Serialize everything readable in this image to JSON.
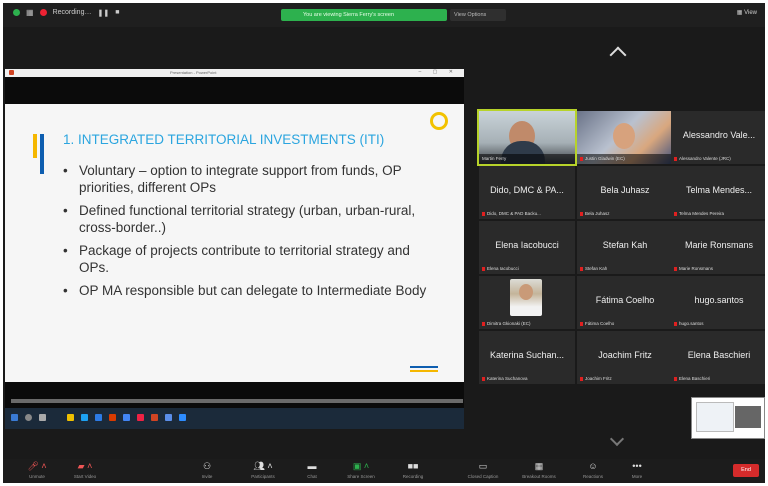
{
  "topbar": {
    "meeting_title": "Recording…",
    "share_banner": "You are viewing Sierra Ferry's screen",
    "view_options": "View Options",
    "view_button": "View"
  },
  "shared_screen": {
    "window_title": "Presentation - PowerPoint"
  },
  "slide": {
    "title": "1. INTEGRATED TERRITORIAL INVESTMENTS (ITI)",
    "bullets": [
      "Voluntary – option to integrate support from funds, OP priorities, different OPs",
      "Defined functional territorial strategy (urban, urban-rural, cross-border..)",
      "Package of projects contribute to territorial strategy and OPs.",
      "OP MA responsible but can delegate to Intermediate Body"
    ],
    "accent_blue": "#2ba5df",
    "accent_yellow": "#f5b700"
  },
  "gallery": {
    "tiles": [
      {
        "name": "",
        "tag": "Martin Ferry",
        "video": true
      },
      {
        "name": "",
        "tag": "Justin Gladwin (EC)",
        "video": true
      },
      {
        "name": "Alessandro Vale...",
        "tag": "Alessandro Valente (JRC)",
        "video": false
      },
      {
        "name": "Dido, DMC & PA...",
        "tag": "Dido, DMC & PAD Backu...",
        "video": false
      },
      {
        "name": "Bela Juhasz",
        "tag": "Bela Juhasz",
        "video": false
      },
      {
        "name": "Telma Mendes...",
        "tag": "Telma Mendes Pereira",
        "video": false
      },
      {
        "name": "Elena Iacobucci",
        "tag": "Elena Iacobucci",
        "video": false
      },
      {
        "name": "Stefan Kah",
        "tag": "Stefan Kah",
        "video": false
      },
      {
        "name": "Marie Ronsmans",
        "tag": "Marie Ronsmans",
        "video": false
      },
      {
        "name": "",
        "tag": "Dimitra Gkionaki (EC)",
        "video": true
      },
      {
        "name": "Fátima Coelho",
        "tag": "Fátima Coelho",
        "video": false
      },
      {
        "name": "hugo.santos",
        "tag": "hugo.santos",
        "video": false
      },
      {
        "name": "Katerina Suchan...",
        "tag": "Katerina Suchanova",
        "video": false
      },
      {
        "name": "Joachim Fritz",
        "tag": "Joachim Fritz",
        "video": false
      },
      {
        "name": "Elena Baschieri",
        "tag": "Elena Baschieri",
        "video": false
      }
    ]
  },
  "toolbar": {
    "unmute": "Unmute",
    "start_video": "Start Video",
    "invite": "Invite",
    "participants": "Participants",
    "chat": "Chat",
    "share_screen": "Share Screen",
    "recording": "Recording",
    "closed_caption": "Closed Caption",
    "breakout_rooms": "Breakout Rooms",
    "reactions": "Reactions",
    "more": "More",
    "end": "End"
  },
  "colors": {
    "zoom_green": "#2db14e",
    "end_red": "#d52b2b",
    "background": "#1a1a1a"
  }
}
